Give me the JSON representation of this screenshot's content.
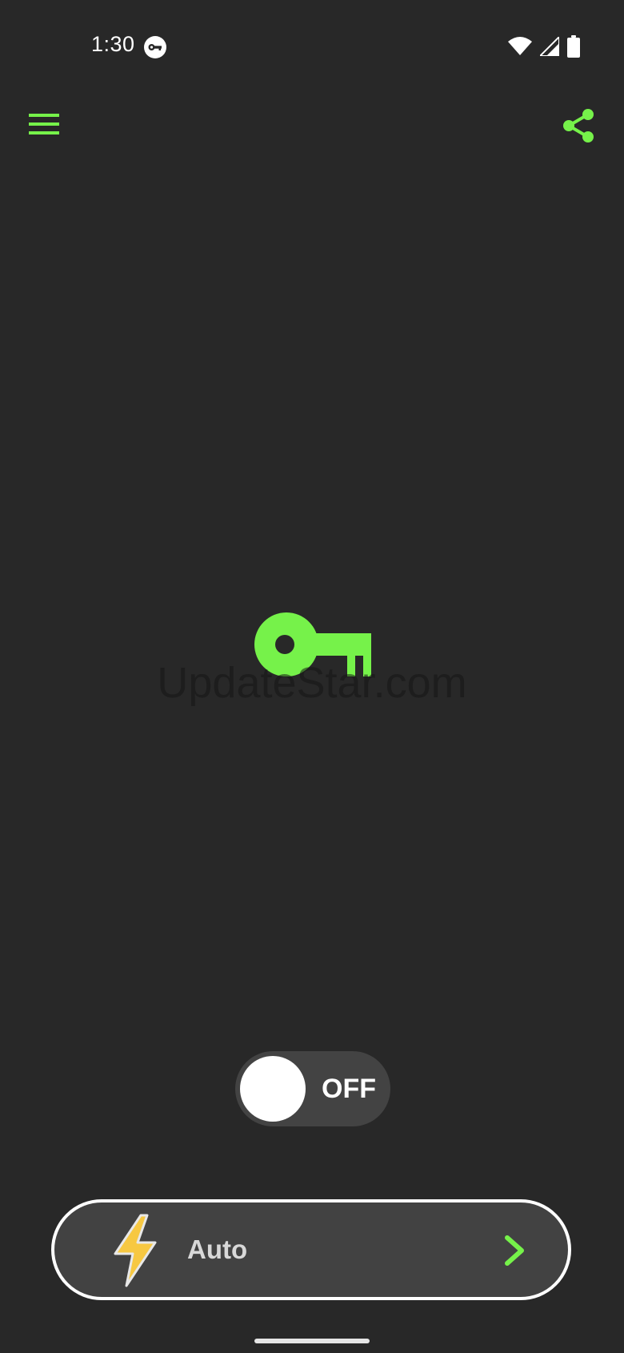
{
  "status_bar": {
    "time": "1:30",
    "icons": [
      "vpn-key-icon",
      "wifi-icon",
      "cellular-signal-icon",
      "battery-icon"
    ]
  },
  "app_bar": {
    "menu_icon": "hamburger-menu-icon",
    "share_icon": "share-icon"
  },
  "center": {
    "icon": "key-icon",
    "watermark": "UpdateStar.com"
  },
  "connection_toggle": {
    "label": "OFF",
    "state": "off"
  },
  "server_selector": {
    "icon": "lightning-bolt-icon",
    "label": "Auto",
    "chevron": "chevron-right-icon"
  },
  "colors": {
    "background": "#282828",
    "accent": "#76F24A",
    "toggle_track": "#434343",
    "selector_bg": "#424242",
    "bolt": "#F7C842"
  }
}
